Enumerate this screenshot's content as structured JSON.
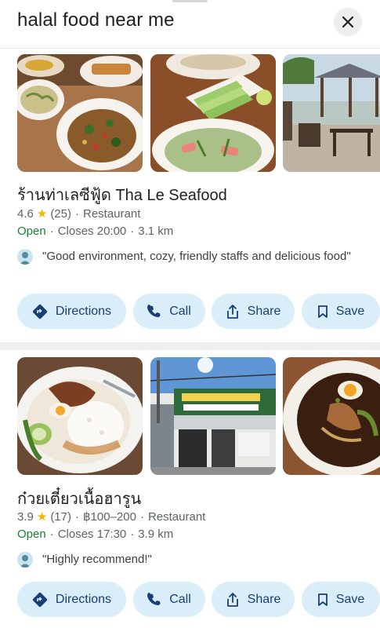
{
  "search": {
    "query": "halal food near me"
  },
  "results": [
    {
      "name": "ร้านท่าเลซีฟู้ด Tha Le Seafood",
      "rating": "4.6",
      "reviews": "(25)",
      "category": "Restaurant",
      "status": "Open",
      "closes": "Closes 20:00",
      "distance": "3.1 km",
      "review_snippet": "\"Good environment, cozy, friendly staffs and delicious food\"",
      "actions": {
        "directions": "Directions",
        "call": "Call",
        "share": "Share",
        "save": "Save"
      }
    },
    {
      "name": "ก๋วยเตี๋ยวเนื้อฮารูน",
      "rating": "3.9",
      "reviews": "(17)",
      "price": "฿100–200",
      "category": "Restaurant",
      "status": "Open",
      "closes": "Closes 17:30",
      "distance": "3.9 km",
      "review_snippet": "\"Highly recommend!\"",
      "actions": {
        "directions": "Directions",
        "call": "Call",
        "share": "Share",
        "save": "Save"
      }
    }
  ],
  "icons": {
    "close": "close-icon",
    "star": "star-icon",
    "directions": "directions-icon",
    "call": "phone-icon",
    "share": "share-icon",
    "save": "bookmark-icon",
    "avatar": "user-avatar-icon"
  },
  "colors": {
    "open": "#188038",
    "star": "#f4b400",
    "chip_bg": "#d9eef8",
    "chip_text": "#1a3f73"
  }
}
